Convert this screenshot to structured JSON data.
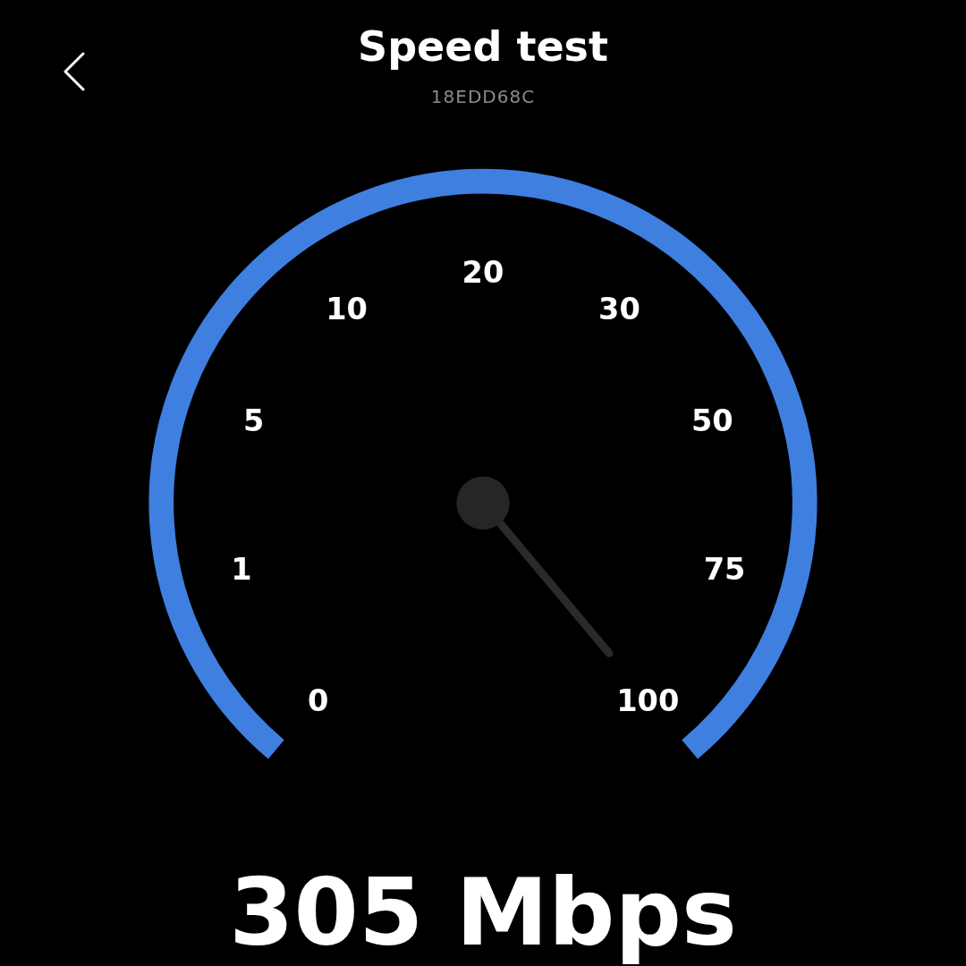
{
  "header": {
    "title": "Speed test",
    "subtitle": "18EDD68C"
  },
  "gauge": {
    "scale_labels": [
      "0",
      "1",
      "5",
      "10",
      "20",
      "30",
      "50",
      "75",
      "100"
    ]
  },
  "reading": "305 Mbps"
}
